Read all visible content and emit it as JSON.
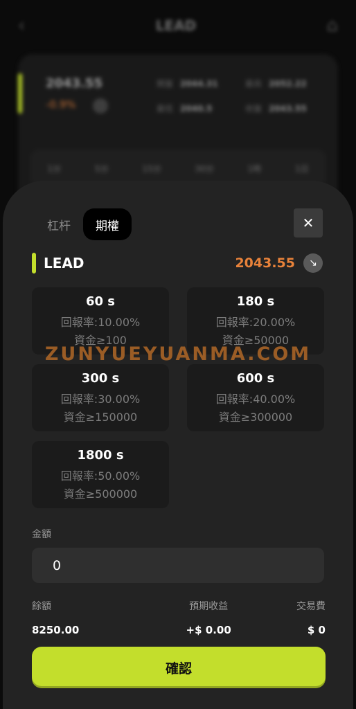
{
  "background": {
    "title": "LEAD",
    "price": "2043.55",
    "change": "-0.9%",
    "stats": [
      {
        "label": "開盤",
        "value": "2044.31"
      },
      {
        "label": "最高",
        "value": "2052.22"
      },
      {
        "label": "最低",
        "value": "2040.5"
      },
      {
        "label": "收盤",
        "value": "2043.55"
      }
    ],
    "tabs": [
      "1分",
      "5分",
      "15分",
      "30分",
      "1時",
      "1日"
    ]
  },
  "sheet": {
    "tabs": [
      {
        "label": "杠杆",
        "active": false
      },
      {
        "label": "期權",
        "active": true
      }
    ],
    "close_icon": "close-icon",
    "symbol": "LEAD",
    "price": "2043.55",
    "price_color": "#e8823a",
    "accent_color": "#c3de2c",
    "trend_icon": "↘",
    "options": [
      {
        "duration": "60 s",
        "rate": "回報率:10.00%",
        "min": "資金≥100"
      },
      {
        "duration": "180 s",
        "rate": "回報率:20.00%",
        "min": "資金≥50000"
      },
      {
        "duration": "300 s",
        "rate": "回報率:30.00%",
        "min": "資金≥150000"
      },
      {
        "duration": "600 s",
        "rate": "回報率:40.00%",
        "min": "資金≥300000"
      },
      {
        "duration": "1800 s",
        "rate": "回報率:50.00%",
        "min": "資金≥500000"
      }
    ],
    "amount": {
      "label": "金額",
      "value": "0"
    },
    "summary": {
      "balance_label": "餘額",
      "balance_value": "8250.00",
      "expected_label": "預期收益",
      "expected_value": "+$ 0.00",
      "fee_label": "交易費",
      "fee_value": "$ 0"
    },
    "confirm_label": "確認"
  },
  "watermark": "ZUNYUEYUANMA.COM"
}
